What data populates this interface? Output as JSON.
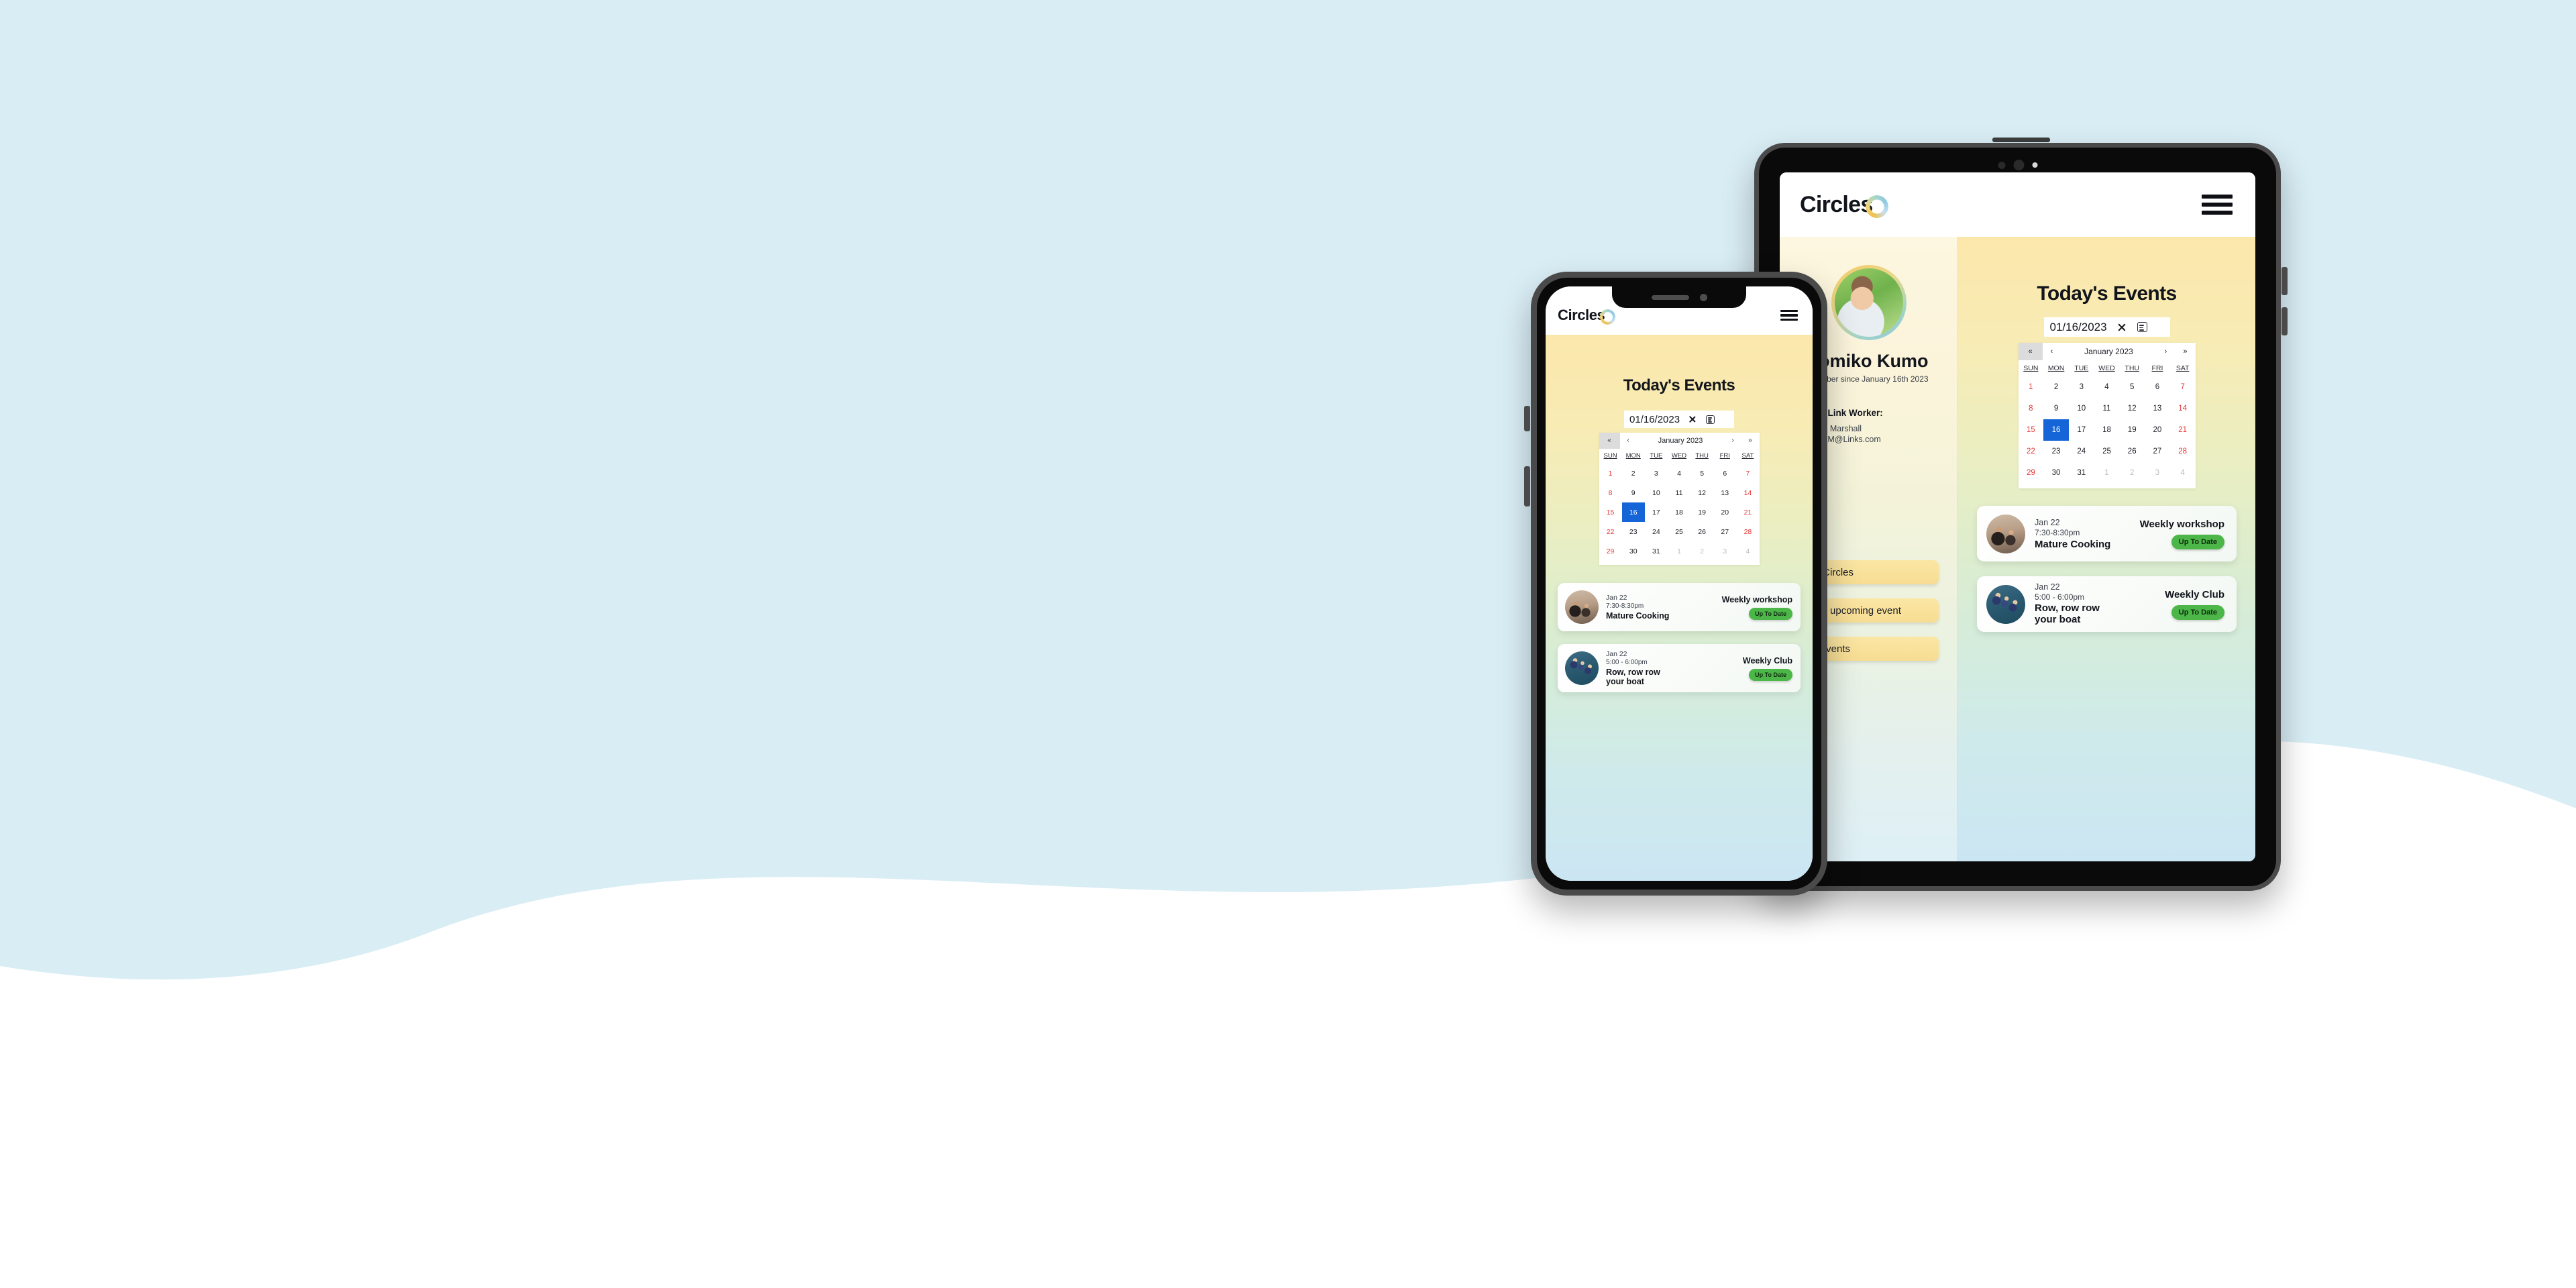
{
  "app": {
    "brand": "Circles",
    "menu_icon": "hamburger-icon"
  },
  "background": {
    "blue": "#d9edf5",
    "white": "#ffffff"
  },
  "panel": {
    "title": "Today's Events"
  },
  "date_picker": {
    "value": "01/16/2023",
    "clear_icon": "close-x-icon",
    "calendar_icon": "calendar-note-icon"
  },
  "calendar": {
    "month_label": "January 2023",
    "nav": {
      "first": "«",
      "prev": "‹",
      "next": "›",
      "last": "»"
    },
    "dows": [
      "SUN",
      "MON",
      "TUE",
      "WED",
      "THU",
      "FRI",
      "SAT"
    ],
    "selected_day": "16",
    "selected_color": "#1565d8",
    "weekend_color": "#e53535",
    "weeks": [
      [
        {
          "d": "1",
          "k": "wk"
        },
        {
          "d": "2",
          "k": ""
        },
        {
          "d": "3",
          "k": ""
        },
        {
          "d": "4",
          "k": ""
        },
        {
          "d": "5",
          "k": ""
        },
        {
          "d": "6",
          "k": ""
        },
        {
          "d": "7",
          "k": "wk"
        }
      ],
      [
        {
          "d": "8",
          "k": "wk"
        },
        {
          "d": "9",
          "k": ""
        },
        {
          "d": "10",
          "k": ""
        },
        {
          "d": "11",
          "k": ""
        },
        {
          "d": "12",
          "k": ""
        },
        {
          "d": "13",
          "k": ""
        },
        {
          "d": "14",
          "k": "wk"
        }
      ],
      [
        {
          "d": "15",
          "k": "wk"
        },
        {
          "d": "16",
          "k": "sel"
        },
        {
          "d": "17",
          "k": ""
        },
        {
          "d": "18",
          "k": ""
        },
        {
          "d": "19",
          "k": ""
        },
        {
          "d": "20",
          "k": ""
        },
        {
          "d": "21",
          "k": "wk"
        }
      ],
      [
        {
          "d": "22",
          "k": "wk"
        },
        {
          "d": "23",
          "k": ""
        },
        {
          "d": "24",
          "k": ""
        },
        {
          "d": "25",
          "k": ""
        },
        {
          "d": "26",
          "k": ""
        },
        {
          "d": "27",
          "k": ""
        },
        {
          "d": "28",
          "k": "wk"
        }
      ],
      [
        {
          "d": "29",
          "k": "wk"
        },
        {
          "d": "30",
          "k": ""
        },
        {
          "d": "31",
          "k": ""
        },
        {
          "d": "1",
          "k": "mut"
        },
        {
          "d": "2",
          "k": "mut"
        },
        {
          "d": "3",
          "k": "mut"
        },
        {
          "d": "4",
          "k": "mut"
        }
      ]
    ]
  },
  "events": [
    {
      "date": "Jan 22",
      "time": "7:30-8:30pm",
      "name": "Mature Cooking",
      "type": "Weekly workshop",
      "status": "Up To Date",
      "status_color": "#4cb648",
      "thumb": "cooking-photo"
    },
    {
      "date": "Jan 22",
      "time": "5:00 - 6:00pm",
      "name": "Row, row row your boat",
      "type": "Weekly Club",
      "status": "Up To Date",
      "status_color": "#4cb648",
      "thumb": "rowing-photo"
    }
  ],
  "profile": {
    "name": "Tomiko Kumo",
    "since": "Member since January 16th 2023",
    "link_worker_title": "Your Link Worker:",
    "link_worker_name": "Sarah Marshall",
    "link_worker_email": "SarahM@Links.com",
    "avatar": "member-avatar-photo",
    "buttons": [
      "My Circles",
      "Next upcoming event",
      "All events"
    ]
  }
}
